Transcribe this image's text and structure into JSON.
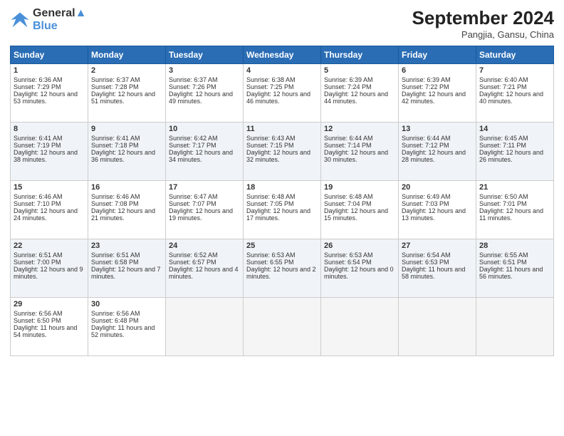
{
  "header": {
    "logo_line1": "General",
    "logo_line2": "Blue",
    "month": "September 2024",
    "location": "Pangjia, Gansu, China"
  },
  "weekdays": [
    "Sunday",
    "Monday",
    "Tuesday",
    "Wednesday",
    "Thursday",
    "Friday",
    "Saturday"
  ],
  "weeks": [
    [
      {
        "day": 1,
        "sunrise": "6:36 AM",
        "sunset": "7:29 PM",
        "daylight": "12 hours and 53 minutes."
      },
      {
        "day": 2,
        "sunrise": "6:37 AM",
        "sunset": "7:28 PM",
        "daylight": "12 hours and 51 minutes."
      },
      {
        "day": 3,
        "sunrise": "6:37 AM",
        "sunset": "7:26 PM",
        "daylight": "12 hours and 49 minutes."
      },
      {
        "day": 4,
        "sunrise": "6:38 AM",
        "sunset": "7:25 PM",
        "daylight": "12 hours and 46 minutes."
      },
      {
        "day": 5,
        "sunrise": "6:39 AM",
        "sunset": "7:24 PM",
        "daylight": "12 hours and 44 minutes."
      },
      {
        "day": 6,
        "sunrise": "6:39 AM",
        "sunset": "7:22 PM",
        "daylight": "12 hours and 42 minutes."
      },
      {
        "day": 7,
        "sunrise": "6:40 AM",
        "sunset": "7:21 PM",
        "daylight": "12 hours and 40 minutes."
      }
    ],
    [
      {
        "day": 8,
        "sunrise": "6:41 AM",
        "sunset": "7:19 PM",
        "daylight": "12 hours and 38 minutes."
      },
      {
        "day": 9,
        "sunrise": "6:41 AM",
        "sunset": "7:18 PM",
        "daylight": "12 hours and 36 minutes."
      },
      {
        "day": 10,
        "sunrise": "6:42 AM",
        "sunset": "7:17 PM",
        "daylight": "12 hours and 34 minutes."
      },
      {
        "day": 11,
        "sunrise": "6:43 AM",
        "sunset": "7:15 PM",
        "daylight": "12 hours and 32 minutes."
      },
      {
        "day": 12,
        "sunrise": "6:44 AM",
        "sunset": "7:14 PM",
        "daylight": "12 hours and 30 minutes."
      },
      {
        "day": 13,
        "sunrise": "6:44 AM",
        "sunset": "7:12 PM",
        "daylight": "12 hours and 28 minutes."
      },
      {
        "day": 14,
        "sunrise": "6:45 AM",
        "sunset": "7:11 PM",
        "daylight": "12 hours and 26 minutes."
      }
    ],
    [
      {
        "day": 15,
        "sunrise": "6:46 AM",
        "sunset": "7:10 PM",
        "daylight": "12 hours and 24 minutes."
      },
      {
        "day": 16,
        "sunrise": "6:46 AM",
        "sunset": "7:08 PM",
        "daylight": "12 hours and 21 minutes."
      },
      {
        "day": 17,
        "sunrise": "6:47 AM",
        "sunset": "7:07 PM",
        "daylight": "12 hours and 19 minutes."
      },
      {
        "day": 18,
        "sunrise": "6:48 AM",
        "sunset": "7:05 PM",
        "daylight": "12 hours and 17 minutes."
      },
      {
        "day": 19,
        "sunrise": "6:48 AM",
        "sunset": "7:04 PM",
        "daylight": "12 hours and 15 minutes."
      },
      {
        "day": 20,
        "sunrise": "6:49 AM",
        "sunset": "7:03 PM",
        "daylight": "12 hours and 13 minutes."
      },
      {
        "day": 21,
        "sunrise": "6:50 AM",
        "sunset": "7:01 PM",
        "daylight": "12 hours and 11 minutes."
      }
    ],
    [
      {
        "day": 22,
        "sunrise": "6:51 AM",
        "sunset": "7:00 PM",
        "daylight": "12 hours and 9 minutes."
      },
      {
        "day": 23,
        "sunrise": "6:51 AM",
        "sunset": "6:58 PM",
        "daylight": "12 hours and 7 minutes."
      },
      {
        "day": 24,
        "sunrise": "6:52 AM",
        "sunset": "6:57 PM",
        "daylight": "12 hours and 4 minutes."
      },
      {
        "day": 25,
        "sunrise": "6:53 AM",
        "sunset": "6:55 PM",
        "daylight": "12 hours and 2 minutes."
      },
      {
        "day": 26,
        "sunrise": "6:53 AM",
        "sunset": "6:54 PM",
        "daylight": "12 hours and 0 minutes."
      },
      {
        "day": 27,
        "sunrise": "6:54 AM",
        "sunset": "6:53 PM",
        "daylight": "11 hours and 58 minutes."
      },
      {
        "day": 28,
        "sunrise": "6:55 AM",
        "sunset": "6:51 PM",
        "daylight": "11 hours and 56 minutes."
      }
    ],
    [
      {
        "day": 29,
        "sunrise": "6:56 AM",
        "sunset": "6:50 PM",
        "daylight": "11 hours and 54 minutes."
      },
      {
        "day": 30,
        "sunrise": "6:56 AM",
        "sunset": "6:48 PM",
        "daylight": "11 hours and 52 minutes."
      },
      null,
      null,
      null,
      null,
      null
    ]
  ]
}
